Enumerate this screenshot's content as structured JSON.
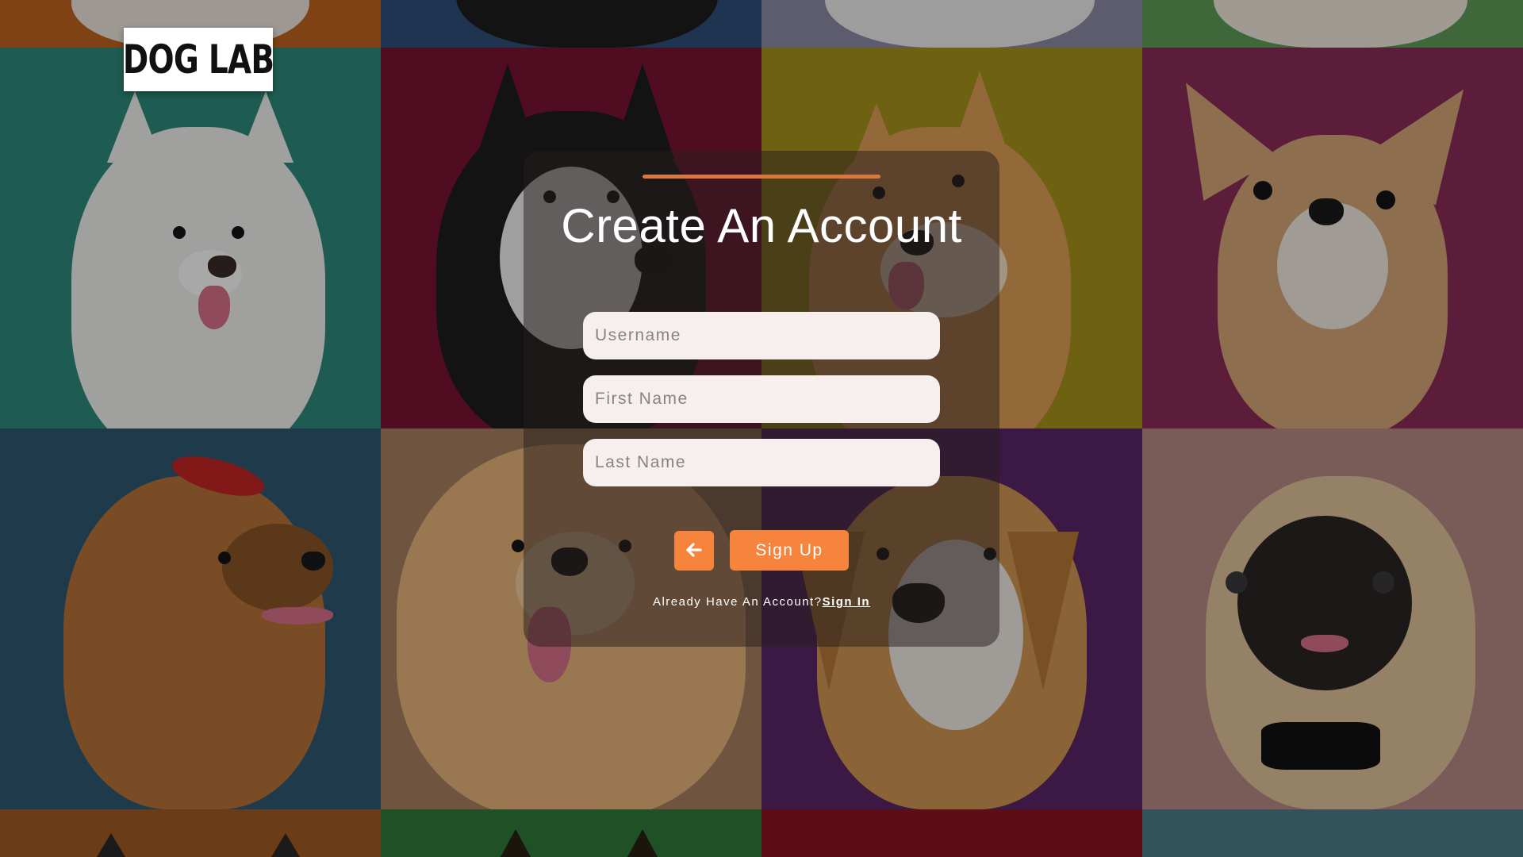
{
  "brand": {
    "logo_text": "DOG LAB"
  },
  "background": {
    "tile_colors": {
      "row0": [
        "#c0651f",
        "#2f4f7a",
        "#8e8aa8",
        "#5f9e58"
      ],
      "row1": [
        "#2e8c7e",
        "#7a1535",
        "#a8941a",
        "#8a2c58"
      ],
      "row2": [
        "#2f5a73",
        "#a98160",
        "#5a2768",
        "#b88a86"
      ],
      "row3": [
        "#a25b25",
        "#2f7a3b",
        "#8c1422",
        "#4f7d8b"
      ]
    }
  },
  "form": {
    "title": "Create An Account",
    "username": {
      "placeholder": "Username",
      "value": ""
    },
    "first_name": {
      "placeholder": "First Name",
      "value": ""
    },
    "last_name": {
      "placeholder": "Last Name",
      "value": ""
    },
    "back_icon": "arrow-left-icon",
    "signup_label": "Sign Up",
    "have_account_text": "Already Have An Account?",
    "signin_link": "Sign In"
  },
  "colors": {
    "accent": "#f6843d",
    "accent_line": "#d9773e",
    "card_overlay": "rgba(40,30,30,0.5)",
    "field_bg": "#f7eeee"
  }
}
